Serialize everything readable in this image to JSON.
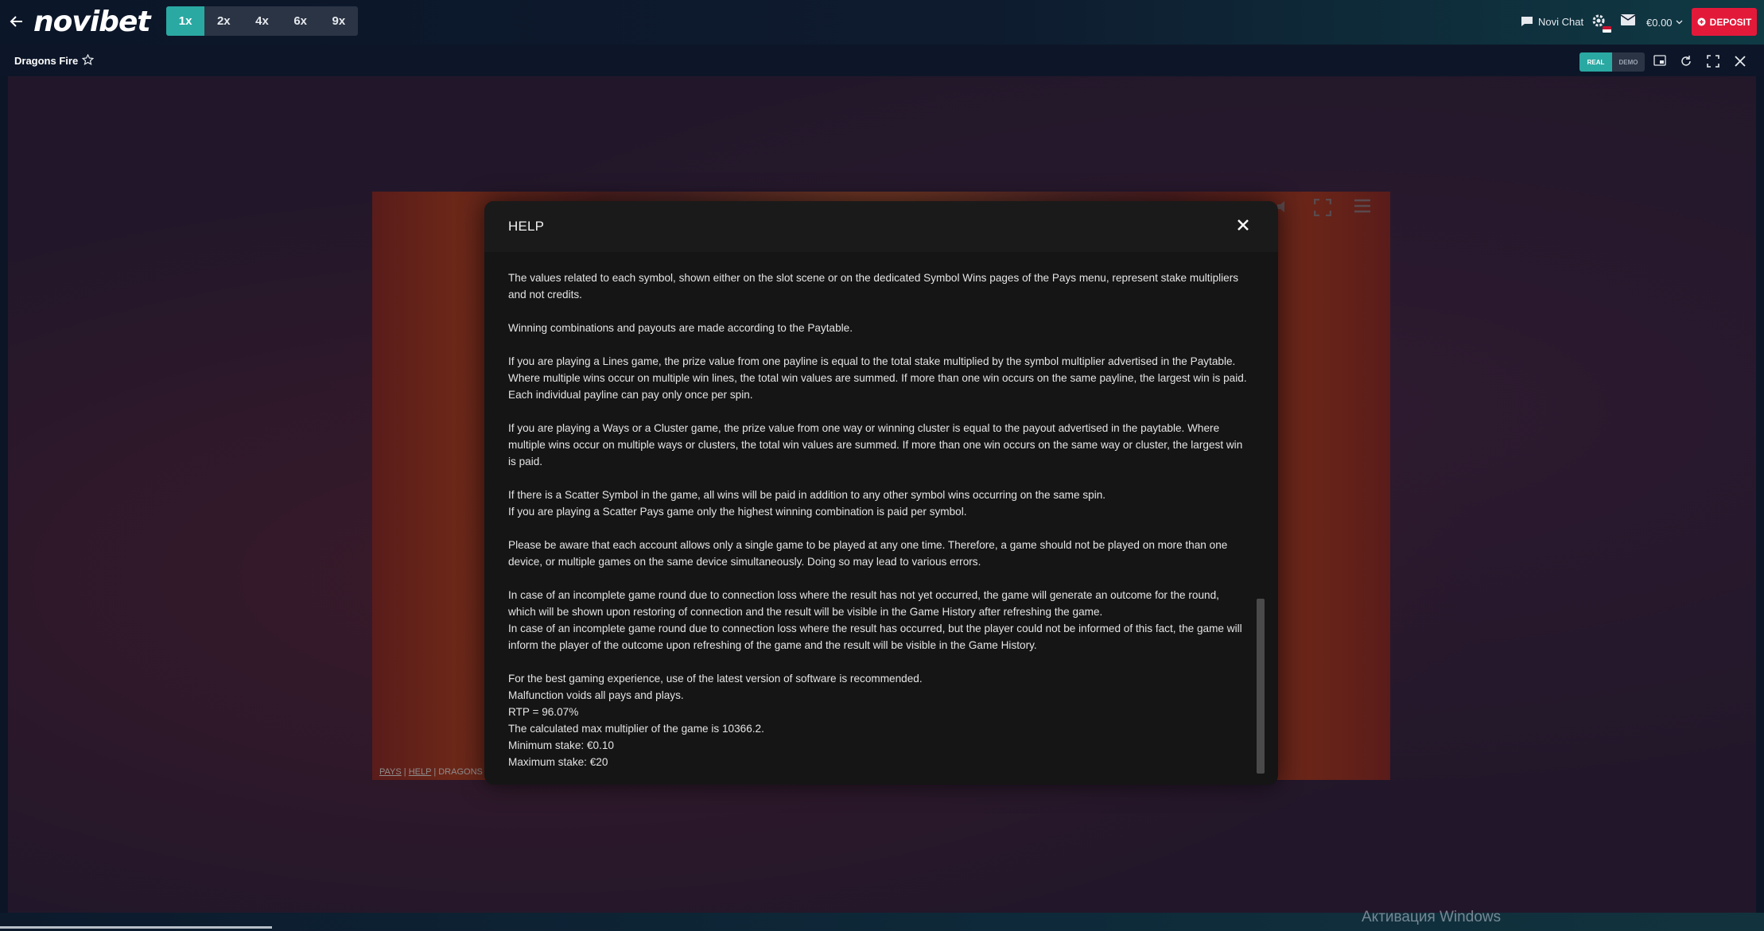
{
  "topbar": {
    "logo": "novibet",
    "speeds": [
      "1x",
      "2x",
      "4x",
      "6x",
      "9x"
    ],
    "active_speed": "1x",
    "chat_label": "Novi Chat",
    "balance": "€0.00",
    "deposit_label": "DEPOSIT"
  },
  "game": {
    "title": "Dragons Fire",
    "mode_real": "REAL",
    "mode_demo": "DEMO",
    "footer_pays": "PAYS",
    "footer_help": "HELP",
    "footer_sep": "|",
    "footer_game": "DRAGONS"
  },
  "help": {
    "title": "HELP",
    "paragraphs": [
      "The values related to each symbol, shown either on the slot scene or on the dedicated Symbol Wins pages of the Pays menu, represent stake multipliers and not credits.",
      "Winning combinations and payouts are made according to the Paytable.",
      "If you are playing a Lines game, the prize value from one payline is equal to the total stake multiplied by the symbol multiplier advertised in the Paytable. Where multiple wins occur on multiple win lines, the total win values are summed. If more than one win occurs on the same payline, the largest win is paid. Each individual payline can pay only once per spin.",
      "If you are playing a Ways or a Cluster game, the prize value from one way or winning cluster is equal to the payout advertised in the paytable. Where multiple wins occur on multiple ways or clusters, the total win values are summed. If more than one win occurs on the same way or cluster, the largest win is paid."
    ],
    "scatter_1": "If there is a Scatter Symbol in the game, all wins will be paid in addition to any other symbol wins occurring on the same spin.",
    "scatter_2": "If you are playing a Scatter Pays game only the highest winning combination is paid per symbol.",
    "account": "Please be aware that each account allows only a single game to be played at any one time. Therefore, a game should not be played on more than one device, or multiple games on the same device simultaneously. Doing so may lead to various errors.",
    "incomplete_1": "In case of an incomplete game round due to connection loss where the result has not yet occurred, the game will generate an outcome for the round, which will be shown upon restoring of connection and the result will be visible in the Game History after refreshing the game.",
    "incomplete_2": "In case of an incomplete game round due to connection loss where the result has occurred, but the player could not be informed of this fact, the game will inform the player of the outcome upon refreshing of the game and the result will be visible in the Game History.",
    "final_lines": [
      "For the best gaming experience, use of the latest version of software is recommended.",
      "Malfunction voids all pays and plays.",
      "RTP = 96.07%",
      "The calculated max multiplier of the game is 10366.2.",
      "Minimum stake: €0.10",
      "Maximum stake: €20"
    ]
  },
  "os": {
    "activation": "Активация Windows"
  },
  "colors": {
    "accent": "#2aa9a3",
    "deposit": "#e3193a"
  }
}
